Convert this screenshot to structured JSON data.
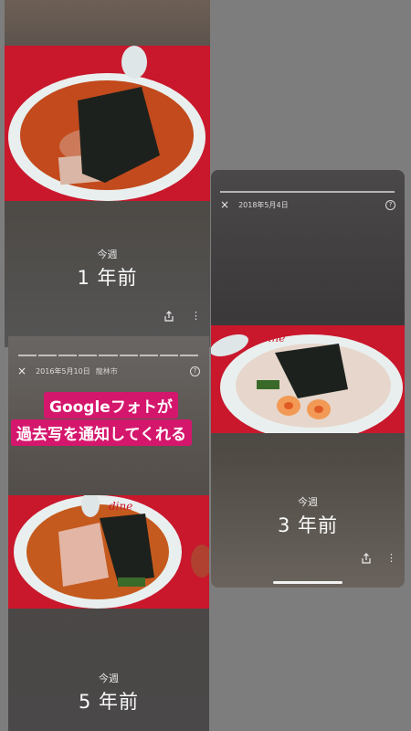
{
  "cards": [
    {
      "period": "今週",
      "ago": "1 年前"
    },
    {
      "date": "2018年5月4日",
      "period": "今週",
      "ago": "3 年前"
    },
    {
      "date": "2016年5月10日",
      "place": "龍林市",
      "period": "今週",
      "ago": "5 年前"
    }
  ],
  "overlay": {
    "line1": "Googleフォトが",
    "line2": "過去写を通知してくれる"
  },
  "icons": {
    "close": "×",
    "help": "?",
    "share": "share-icon",
    "more": "⋮"
  },
  "colors": {
    "overlay_bg": "#d4176c",
    "tray_red": "#c9172c",
    "bowl": "#e9efee"
  }
}
